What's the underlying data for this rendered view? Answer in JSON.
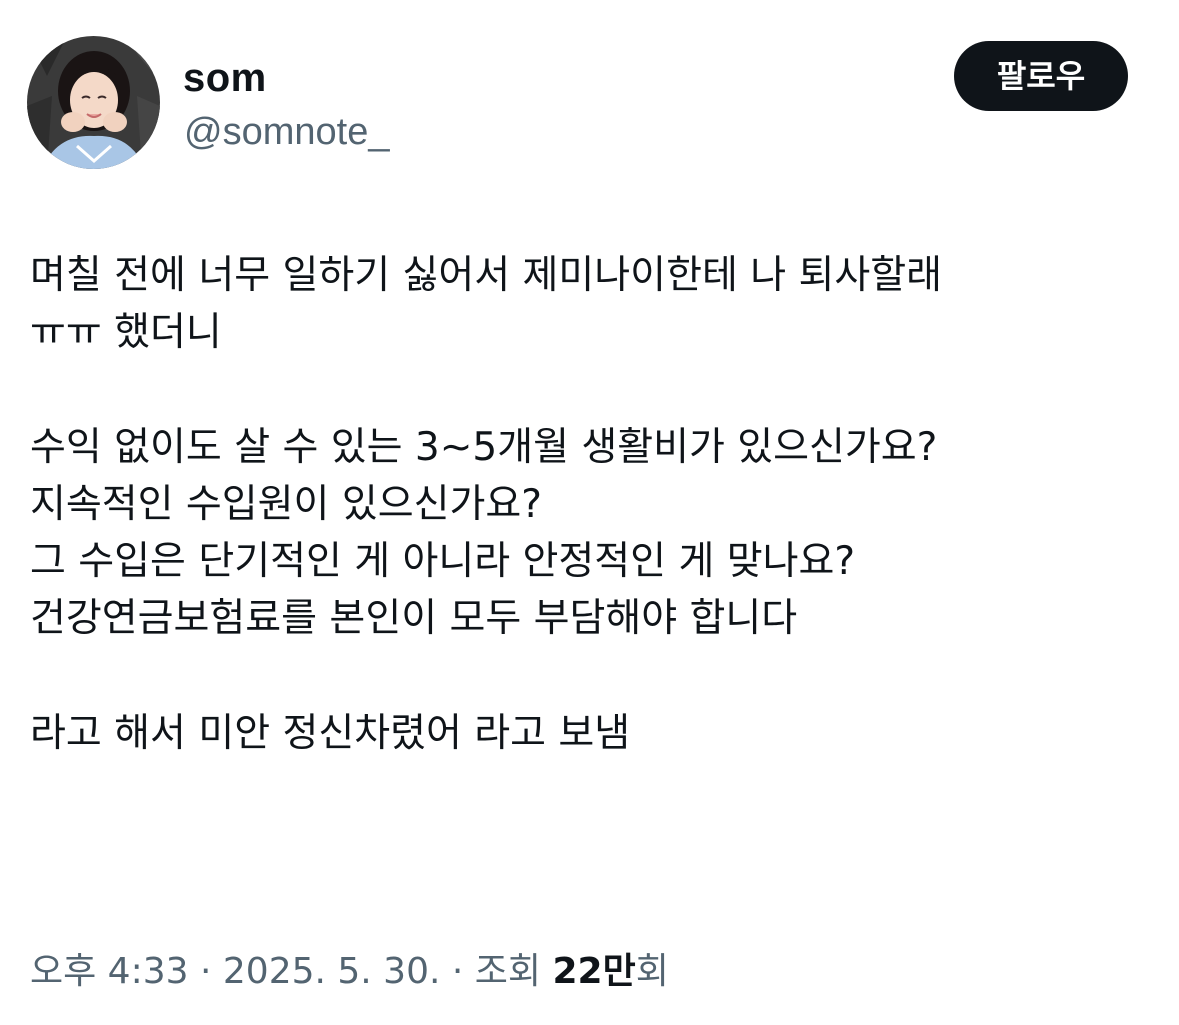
{
  "author": {
    "display_name": "som",
    "handle": "@somnote_",
    "avatar_icon": "profile-photo-avatar"
  },
  "follow_button": {
    "label": "팔로우"
  },
  "tweet": {
    "lines": [
      "며칠 전에 너무 일하기 싫어서 제미나이한테 나 퇴사할래",
      "ㅠㅠ 했더니",
      "",
      "수익 없이도 살 수 있는 3~5개월 생활비가 있으신가요?",
      "지속적인 수입원이 있으신가요?",
      "그 수입은 단기적인 게 아니라 안정적인 게 맞나요?",
      "건강연금보험료를 본인이 모두 부담해야 합니다",
      "",
      "라고 해서 미안 정신차렸어 라고 보냄"
    ]
  },
  "meta": {
    "time": "오후 4:33",
    "separator": "·",
    "date": "2025. 5. 30.",
    "views_label": "조회",
    "views_count": "22만",
    "views_suffix": "회"
  },
  "colors": {
    "text": "#0f1419",
    "secondary": "#536471",
    "button_bg": "#0f1419",
    "button_text": "#ffffff"
  }
}
